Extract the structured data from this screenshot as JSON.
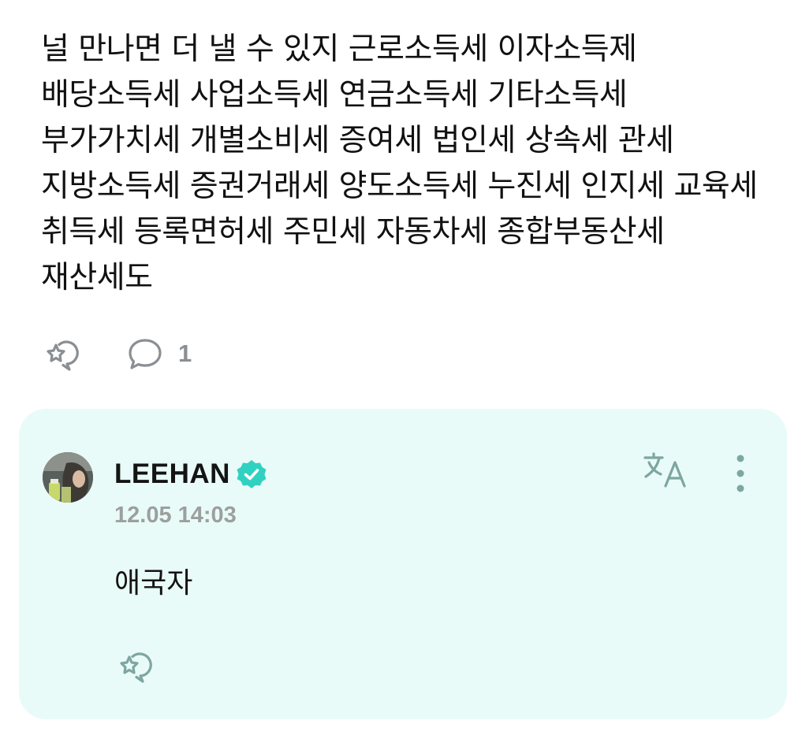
{
  "post": {
    "text": "널 만나면 더 낼 수 있지 근로소득세 이자소득제 배당소득세 사업소득세 연금소득세 기타소득세 부가가치세 개별소비세 증여세 법인세 상속세 관세 지방소득세 증권거래세 양도소득세 누진세 인지세 교육세 취득세 등록면허세 주민세 자동차세 종합부동산세 재산세도",
    "comment_count": "1"
  },
  "reply": {
    "author": "LEEHAN",
    "timestamp": "12.05 14:03",
    "text": "애국자"
  },
  "icons": {
    "react": "add-reaction-icon",
    "comment": "comment-bubble-icon",
    "verified": "verified-badge-icon",
    "translate": "translate-icon",
    "more": "more-vertical-icon"
  },
  "colors": {
    "reply_background": "#e9fbf8",
    "icon_gray": "#8a8f94",
    "verified_teal": "#31d1c2",
    "reply_icon_teal": "#7ea6a2"
  }
}
